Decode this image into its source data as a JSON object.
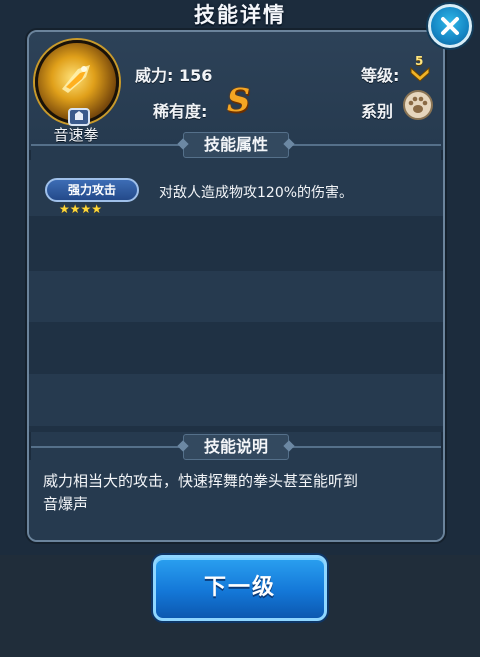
{
  "dialog": {
    "title": "技能详情",
    "close_icon": "close-icon"
  },
  "skill": {
    "name": "音速拳",
    "power_label": "威力: 156",
    "level_label": "等级:",
    "level_value": "5",
    "rarity_label": "稀有度:",
    "rarity_value": "S",
    "type_label": "系别",
    "type_icon": "paw-icon"
  },
  "attributes": {
    "section_title": "技能属性",
    "items": [
      {
        "tag": "强力攻击",
        "stars": 4,
        "description": "对敌人造成物攻120%的伤害。"
      }
    ]
  },
  "explanation": {
    "section_title": "技能说明",
    "text_line1": "威力相当大的攻击，快速挥舞的拳头甚至能听到",
    "text_line2": "音爆声"
  },
  "next_button": {
    "label": "下一级"
  },
  "colors": {
    "accent_blue": "#1478d8",
    "rarity_orange": "#f5a623",
    "star_yellow": "#ffd83a"
  }
}
